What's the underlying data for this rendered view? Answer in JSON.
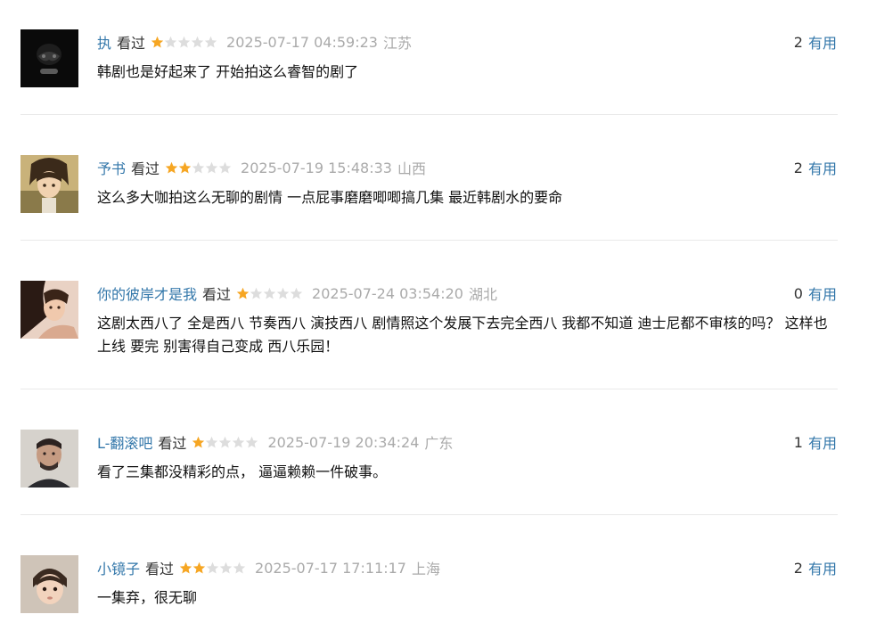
{
  "comments": [
    {
      "author": "执",
      "status": "看过",
      "rating": 1,
      "time": "2025-07-17 04:59:23",
      "location": "江苏",
      "votes": "2",
      "useful_label": "有用",
      "content": "韩剧也是好起来了 开始拍这么睿智的剧了",
      "avatar": "dark-mask-avatar"
    },
    {
      "author": "予书",
      "status": "看过",
      "rating": 2,
      "time": "2025-07-19 15:48:33",
      "location": "山西",
      "votes": "2",
      "useful_label": "有用",
      "content": "这么多大咖拍这么无聊的剧情 一点屁事磨磨唧唧搞几集 最近韩剧水的要命",
      "avatar": "anime-boy-avatar"
    },
    {
      "author": "你的彼岸才是我",
      "status": "看过",
      "rating": 1,
      "time": "2025-07-24 03:54:20",
      "location": "湖北",
      "votes": "0",
      "useful_label": "有用",
      "content": "这剧太西八了 全是西八 节奏西八 演技西八 剧情照这个发展下去完全西八 我都不知道 迪士尼都不审核的吗？ 这样也上线 要完 别害得自己变成 西八乐园！",
      "avatar": "woman-photo-avatar"
    },
    {
      "author": "L-翻滚吧",
      "status": "看过",
      "rating": 1,
      "time": "2025-07-19 20:34:24",
      "location": "广东",
      "votes": "1",
      "useful_label": "有用",
      "content": "看了三集都没精彩的点， 逼逼赖赖一件破事。",
      "avatar": "man-photo-avatar"
    },
    {
      "author": "小镜子",
      "status": "看过",
      "rating": 2,
      "time": "2025-07-17 17:11:17",
      "location": "上海",
      "votes": "2",
      "useful_label": "有用",
      "content": "一集弃，很无聊",
      "avatar": "child-photo-avatar"
    }
  ],
  "colors": {
    "link": "#3377aa",
    "star_on": "#f6a623",
    "star_off": "#dddddd",
    "muted": "#aaaaaa",
    "divider": "#e9e9e9"
  }
}
